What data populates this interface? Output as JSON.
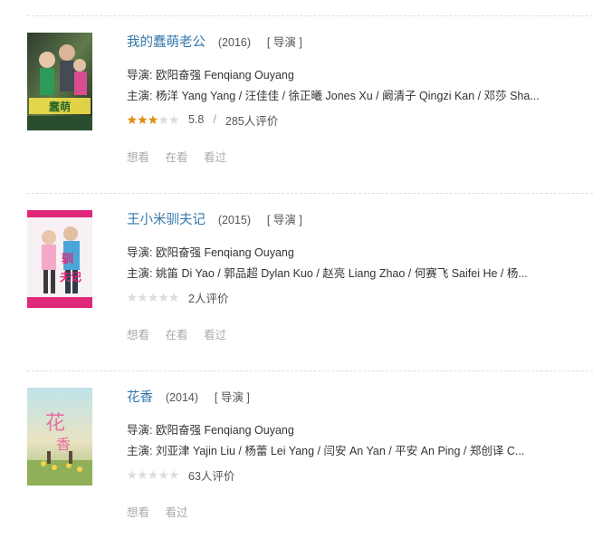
{
  "colors": {
    "title": "#3377aa",
    "star_on": "#e09015",
    "star_off": "#dddddd",
    "separator": "#dddddd"
  },
  "films": [
    {
      "title": "我的蠢萌老公",
      "year": "(2016)",
      "role": "[ 导演 ]",
      "director_label": "导演:",
      "director": "欧阳奋强 Fenqiang Ouyang",
      "cast_label": "主演:",
      "cast": "杨洋 Yang Yang / 汪佳佳 / 徐正曦 Jones Xu / 阚清子 Qingzi Kan / 邓莎 Sha...",
      "rating_fraction": 0.6,
      "score": "5.8",
      "slash": "/",
      "reviews": "285人评价",
      "actions": [
        "想看",
        "在看",
        "看过"
      ],
      "poster_icon": "poster-image"
    },
    {
      "title": "王小米驯夫记",
      "year": "(2015)",
      "role": "[ 导演 ]",
      "director_label": "导演:",
      "director": "欧阳奋强 Fenqiang Ouyang",
      "cast_label": "主演:",
      "cast": "姚笛 Di Yao / 郭品超 Dylan Kuo / 赵亮 Liang Zhao / 何赛飞 Saifei He / 杨...",
      "rating_fraction": 0,
      "score": "",
      "slash": "",
      "reviews": "2人评价",
      "actions": [
        "想看",
        "在看",
        "看过"
      ],
      "poster_icon": "poster-image"
    },
    {
      "title": "花香",
      "year": "(2014)",
      "role": "[ 导演 ]",
      "director_label": "导演:",
      "director": "欧阳奋强 Fenqiang Ouyang",
      "cast_label": "主演:",
      "cast": "刘亚津 Yajin Liu / 杨蕾 Lei Yang / 闫安 An Yan / 平安 An Ping / 郑创译 C...",
      "rating_fraction": 0,
      "score": "",
      "slash": "",
      "reviews": "63人评价",
      "actions": [
        "想看",
        "看过"
      ],
      "poster_icon": "poster-image"
    }
  ]
}
